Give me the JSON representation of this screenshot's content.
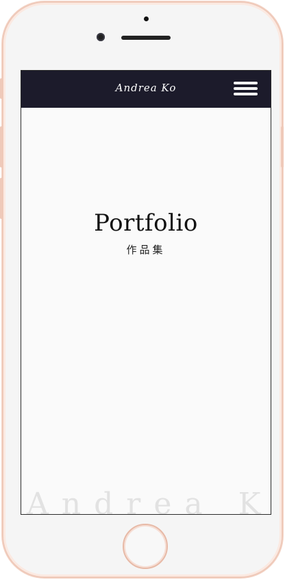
{
  "navbar": {
    "brand": "Andrea Ko",
    "menu_icon": "hamburger-menu-icon"
  },
  "hero": {
    "title": "Portfolio",
    "subtitle": "作品集"
  },
  "watermark": {
    "text": "Andrea Ko"
  },
  "colors": {
    "navbar_bg": "#1c1b2b",
    "screen_bg": "#fafafa",
    "frame_accent": "#efc9b9"
  }
}
